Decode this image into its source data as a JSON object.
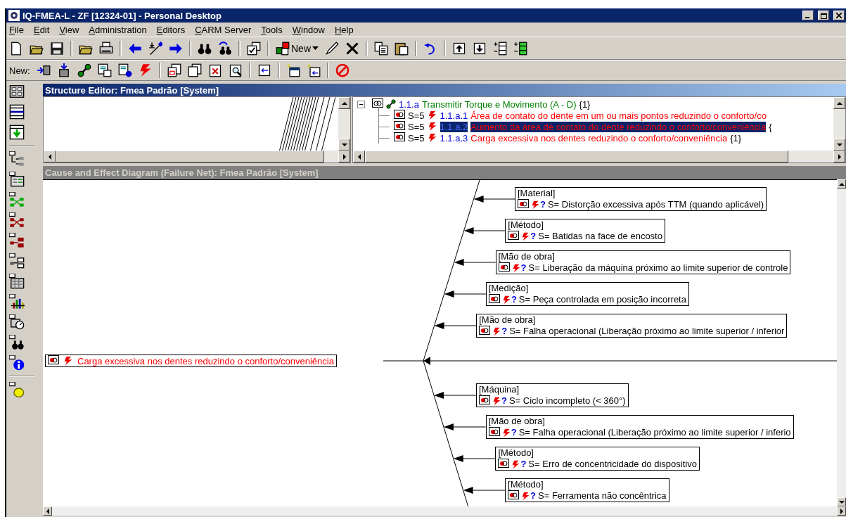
{
  "window": {
    "title": "IQ-FMEA-L - ZF [12324-01] - Personal Desktop"
  },
  "menu": [
    "File",
    "Edit",
    "View",
    "Administration",
    "Editors",
    "CARM Server",
    "Tools",
    "Window",
    "Help"
  ],
  "toolbar": {
    "new_button": "New",
    "new_label": "New:"
  },
  "structure_editor": {
    "title": "Structure Editor: Fmea Padrão [System]",
    "tree": {
      "id": "1.1.a",
      "label": "Transmitir Torque e Movimento (A - D)",
      "count": "{1}",
      "expanded": true,
      "children": [
        {
          "severity": "S=5",
          "id": "1.1.a.1",
          "label": "Área de contato do dente em um ou mais pontos reduzindo o conforto/co",
          "selected": false
        },
        {
          "severity": "S=5",
          "id": "1.1.a.2",
          "label": "Aumento da área de contato do dente reduzindo o conforto/conveniência",
          "count": "{",
          "selected": true
        },
        {
          "severity": "S=5",
          "id": "1.1.a.3",
          "label": "Carga excessiva nos dentes reduzindo o conforto/conveniência",
          "count": "{1}",
          "selected": false
        }
      ]
    }
  },
  "diagram": {
    "title": "Cause and Effect Diagram (Failure Net): Fmea Padrão [System]",
    "effect": {
      "text": "Carga excessiva nos dentes reduzindo o conforto/conveniência"
    },
    "causes_top": [
      {
        "category": "[Material]",
        "flag": "?",
        "text": "S= Distorção excessiva após TTM (quando aplicável)"
      },
      {
        "category": "[Método]",
        "flag": "?",
        "text": "S= Batidas na face de encosto"
      },
      {
        "category": "[Mão de obra]",
        "flag": "?",
        "text": "S= Liberação da máquina próximo ao limite superior de controle"
      },
      {
        "category": "[Medição]",
        "flag": "?",
        "text": "S= Peça controlada em posição incorreta"
      },
      {
        "category": "[Mão de obra]",
        "flag": "?",
        "text": "S= Falha operacional (Liberação próximo ao limite superior / inferior"
      }
    ],
    "causes_bottom": [
      {
        "category": "[Máquina]",
        "flag": "?",
        "text": "S= Ciclo incompleto (< 360°)"
      },
      {
        "category": "[Mão de obra]",
        "flag": "?",
        "text": "S= Falha operacional (Liberação próximo ao limite superior / inferio"
      },
      {
        "category": "[Método]",
        "flag": "?",
        "text": "S= Erro de concentricidade do dispositivo"
      },
      {
        "category": "[Método]",
        "flag": "?",
        "text": "S= Ferramenta não concêntrica"
      }
    ]
  }
}
